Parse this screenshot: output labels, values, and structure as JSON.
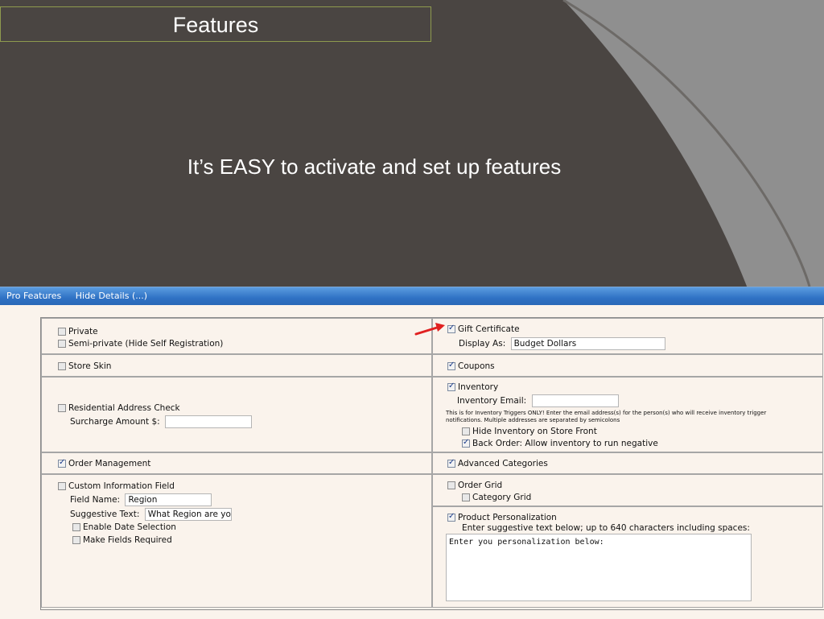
{
  "slide": {
    "title": "Features",
    "subtitle": "It’s EASY to activate and set up features"
  },
  "panel": {
    "header_items": [
      "Pro Features",
      "Hide Details (...)"
    ]
  },
  "left": {
    "private": {
      "label": "Private",
      "checked": false
    },
    "semi_private": {
      "label": "Semi-private (Hide Self Registration)",
      "checked": false
    },
    "store_skin": {
      "label": "Store Skin",
      "checked": false
    },
    "residential": {
      "label": "Residential Address Check",
      "checked": false
    },
    "surcharge_label": "Surcharge Amount $:",
    "surcharge_value": "",
    "order_mgmt": {
      "label": "Order Management",
      "checked": true
    },
    "custom_info": {
      "label": "Custom Information Field",
      "checked": false
    },
    "field_name_label": "Field Name:",
    "field_name_value": "Region",
    "suggestive_label": "Suggestive Text:",
    "suggestive_value": "What Region are you s",
    "date_selection": {
      "label": "Enable Date Selection",
      "checked": false
    },
    "required": {
      "label": "Make Fields Required",
      "checked": false
    }
  },
  "right": {
    "gift": {
      "label": "Gift Certificate",
      "checked": true
    },
    "display_as_label": "Display As:",
    "display_as_value": "Budget Dollars",
    "coupons": {
      "label": "Coupons",
      "checked": true
    },
    "inventory": {
      "label": "Inventory",
      "checked": true
    },
    "inventory_email_label": "Inventory Email:",
    "inventory_email_value": "",
    "inventory_note": "This is for Inventory Triggers ONLY! Enter the email address(s) for the person(s) who will receive inventory trigger notifications. Multiple addresses are separated by semicolons",
    "hide_inventory": {
      "label": "Hide Inventory on Store Front",
      "checked": false
    },
    "back_order": {
      "label": "Back Order: Allow inventory to run negative",
      "checked": true
    },
    "adv_categories": {
      "label": "Advanced Categories",
      "checked": true
    },
    "order_grid": {
      "label": "Order Grid",
      "checked": false
    },
    "category_grid": {
      "label": "Category Grid",
      "checked": false
    },
    "personalization": {
      "label": "Product Personalization",
      "checked": true
    },
    "personalization_hint": "Enter suggestive text below; up to 640 characters including spaces:",
    "personalization_text": "Enter you personalization below:"
  },
  "colors": {
    "background": "#4a4542",
    "arc": "#8f8f8f",
    "title_border": "#8e9a4e",
    "header_blue": "#2f72c4",
    "arrow": "#e02020"
  }
}
